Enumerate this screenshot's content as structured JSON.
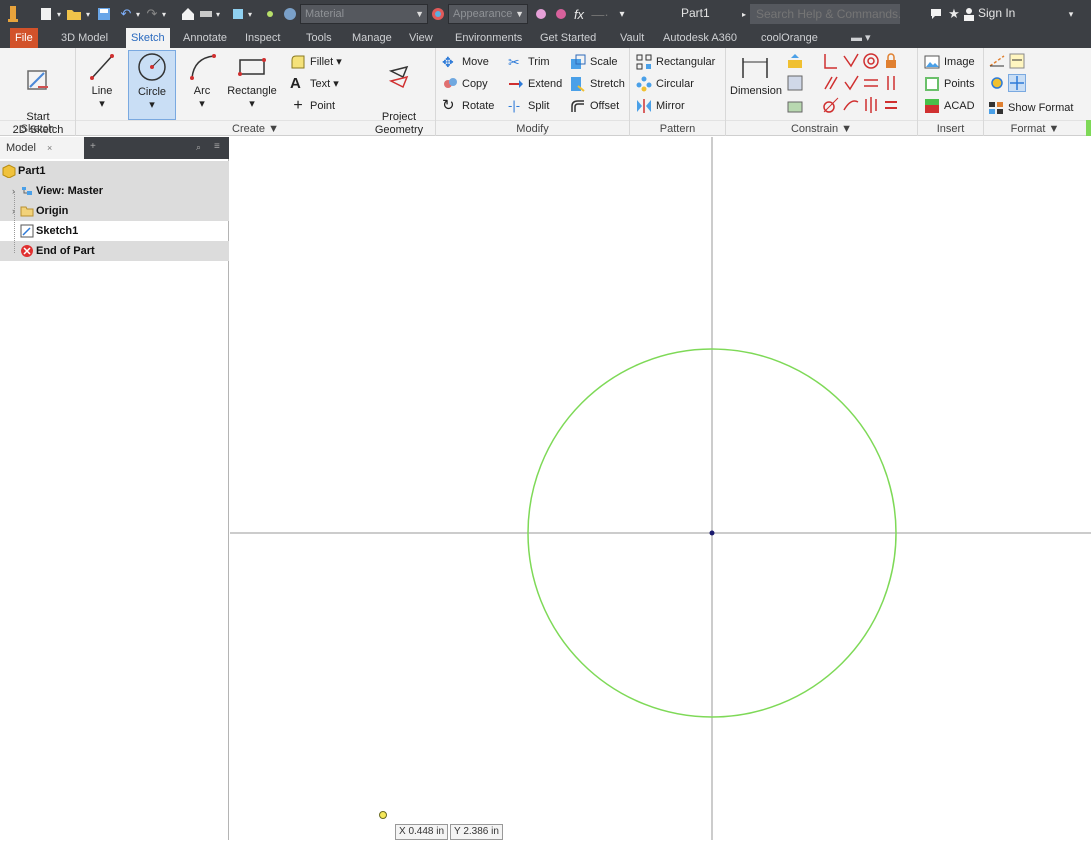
{
  "titlebar": {
    "material_placeholder": "Material",
    "appearance_placeholder": "Appearance",
    "document_title": "Part1",
    "search_placeholder": "Search Help & Commands...",
    "sign_in": "Sign In"
  },
  "tabs": [
    {
      "label": "File"
    },
    {
      "label": "3D Model"
    },
    {
      "label": "Sketch"
    },
    {
      "label": "Annotate"
    },
    {
      "label": "Inspect"
    },
    {
      "label": "Tools"
    },
    {
      "label": "Manage"
    },
    {
      "label": "View"
    },
    {
      "label": "Environments"
    },
    {
      "label": "Get Started"
    },
    {
      "label": "Vault"
    },
    {
      "label": "Autodesk A360"
    },
    {
      "label": "coolOrange"
    }
  ],
  "ribbon": {
    "sketch_panel": {
      "title": "Sketch",
      "start_2d_sketch": "Start\n2D Sketch"
    },
    "create_panel": {
      "title": "Create ▼",
      "line": "Line",
      "circle": "Circle",
      "arc": "Arc",
      "rectangle": "Rectangle",
      "fillet": "Fillet ▾",
      "text": "Text ▾",
      "point": "Point",
      "project_geometry": "Project\nGeometry"
    },
    "modify_panel": {
      "title": "Modify",
      "move": "Move",
      "trim": "Trim",
      "scale": "Scale",
      "copy": "Copy",
      "extend": "Extend",
      "stretch": "Stretch",
      "rotate": "Rotate",
      "split": "Split",
      "offset": "Offset"
    },
    "pattern_panel": {
      "title": "Pattern",
      "rectangular": "Rectangular",
      "circular": "Circular",
      "mirror": "Mirror"
    },
    "constrain_panel": {
      "title": "Constrain ▼",
      "dimension": "Dimension"
    },
    "insert_panel": {
      "title": "Insert",
      "image": "Image",
      "points": "Points",
      "acad": "ACAD"
    },
    "format_panel": {
      "title": "Format ▼",
      "show_format": "Show Format"
    }
  },
  "browser": {
    "tab_label": "Model",
    "tab_close": "×",
    "items": [
      {
        "label": "Part1"
      },
      {
        "label": "View: Master"
      },
      {
        "label": "Origin"
      },
      {
        "label": "Sketch1"
      },
      {
        "label": "End of Part"
      }
    ]
  },
  "status": {
    "x_label": "X",
    "x_value": "0.448 in",
    "y_label": "Y",
    "y_value": "2.386 in"
  },
  "colors": {
    "titlebar": "#3c3f44",
    "ribbon_bg": "#f3f3f3",
    "file_tab": "#d2522a",
    "active_tab_text": "#2a6abf",
    "sketch_geometry": "#7ed957",
    "axis": "#9a9a9a",
    "center_point": "#1a1a6e"
  }
}
